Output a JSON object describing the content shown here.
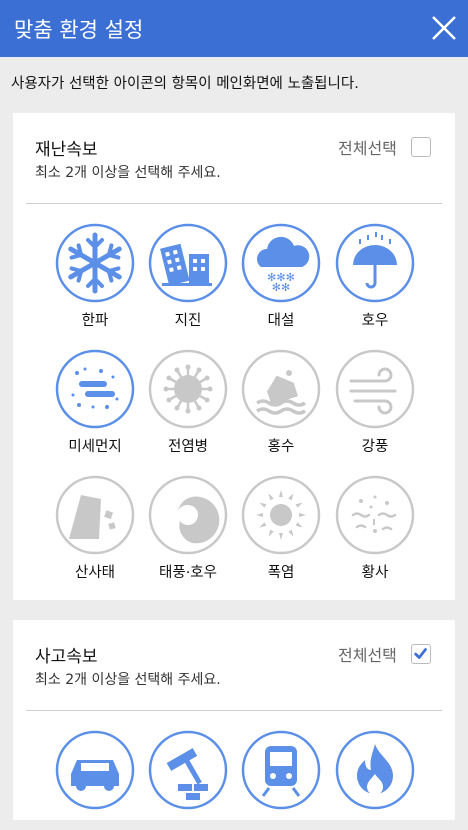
{
  "header": {
    "title": "맞춤 환경 설정"
  },
  "notice": "사용자가 선택한 아이콘의 항목이 메인화면에 노출됩니다.",
  "colors": {
    "header": "#3b6fd4",
    "selected": "#5b8fe8",
    "unselected": "#c8c8c8"
  },
  "disaster": {
    "title": "재난속보",
    "subtitle": "최소 2개 이상을 선택해 주세요.",
    "select_all_label": "전체선택",
    "select_all_checked": false,
    "items": [
      {
        "label": "한파",
        "icon": "snowflake-icon",
        "selected": true
      },
      {
        "label": "지진",
        "icon": "earthquake-icon",
        "selected": true
      },
      {
        "label": "대설",
        "icon": "heavy-snow-icon",
        "selected": true
      },
      {
        "label": "호우",
        "icon": "umbrella-rain-icon",
        "selected": true
      },
      {
        "label": "미세먼지",
        "icon": "fine-dust-icon",
        "selected": true
      },
      {
        "label": "전염병",
        "icon": "virus-icon",
        "selected": false
      },
      {
        "label": "홍수",
        "icon": "flood-icon",
        "selected": false
      },
      {
        "label": "강풍",
        "icon": "wind-icon",
        "selected": false
      },
      {
        "label": "산사태",
        "icon": "landslide-icon",
        "selected": false
      },
      {
        "label": "태풍·호우",
        "icon": "typhoon-icon",
        "selected": false
      },
      {
        "label": "폭염",
        "icon": "sun-heat-icon",
        "selected": false
      },
      {
        "label": "황사",
        "icon": "yellow-dust-icon",
        "selected": false
      }
    ]
  },
  "accident": {
    "title": "사고속보",
    "subtitle": "최소 2개 이상을 선택해 주세요.",
    "select_all_label": "전체선택",
    "select_all_checked": true,
    "items": [
      {
        "icon": "car-icon",
        "selected": true
      },
      {
        "icon": "construction-icon",
        "selected": true
      },
      {
        "icon": "train-icon",
        "selected": true
      },
      {
        "icon": "fire-icon",
        "selected": true
      }
    ]
  }
}
